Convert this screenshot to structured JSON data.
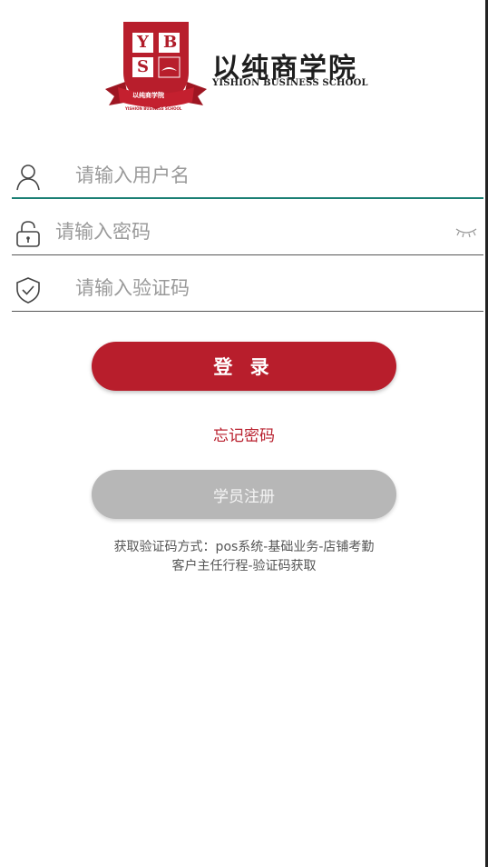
{
  "brand": {
    "crest_letters": [
      "Y",
      "B",
      "S"
    ],
    "ribbon_text": "以纯商学院",
    "ribbon_subtext": "YISHION BUSINESS SCHOOL",
    "name_cn": "以纯商学院",
    "name_en": "YISHION BUSINESS SCHOOL"
  },
  "form": {
    "username": {
      "placeholder": "请输入用户名",
      "value": "",
      "icon": "user-icon"
    },
    "password": {
      "placeholder": "请输入密码",
      "value": "",
      "icon": "lock-icon",
      "toggle_icon": "eye-closed-icon"
    },
    "captcha": {
      "placeholder": "请输入验证码",
      "value": "",
      "icon": "shield-check-icon"
    }
  },
  "actions": {
    "login_label": "登 录",
    "forgot_label": "忘记密码",
    "register_label": "学员注册"
  },
  "hint": {
    "line1": "获取验证码方式：pos系统-基础业务-店铺考勤",
    "line2": "客户主任行程-验证码获取"
  },
  "colors": {
    "primary": "#b81e2c",
    "active_underline": "#1a7f74",
    "disabled_button": "#b7b7b7",
    "text_muted": "#9a9a9a"
  }
}
